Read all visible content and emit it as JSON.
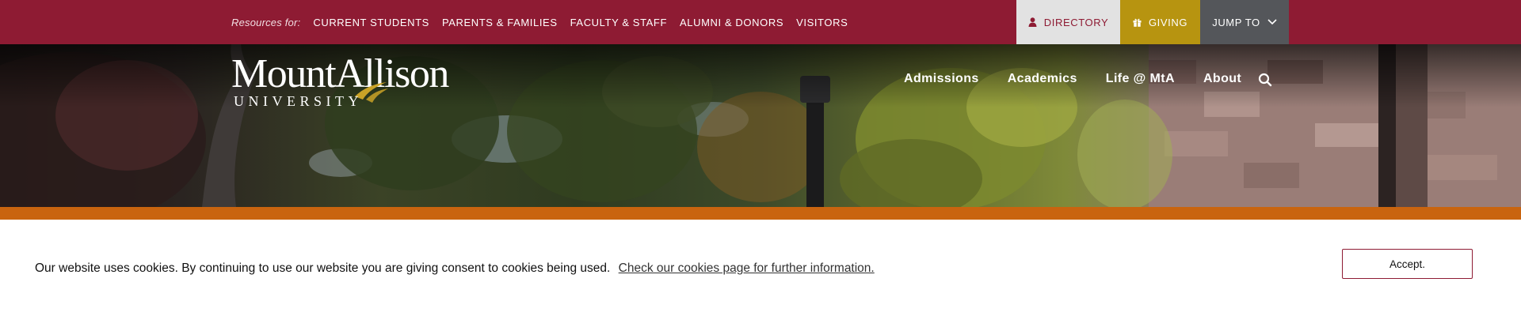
{
  "colors": {
    "topbar_bg": "#8e1b33",
    "directory_bg": "#e2e2e2",
    "giving_bg": "#b79410",
    "jump_bg": "#54565a",
    "accent_stripe": "#c9640f",
    "accept_border": "#8e1b33"
  },
  "topbar": {
    "resources_label": "Resources for:",
    "links": [
      "CURRENT STUDENTS",
      "PARENTS & FAMILIES",
      "FACULTY & STAFF",
      "ALUMNI & DONORS",
      "VISITORS"
    ],
    "directory": {
      "label": "DIRECTORY",
      "icon": "person-icon"
    },
    "giving": {
      "label": "GIVING",
      "icon": "gift-icon"
    },
    "jump_to": {
      "label": "JUMP TO",
      "icon": "chevron-down-icon"
    }
  },
  "header": {
    "logo_main": "MountAllison",
    "logo_sub": "UNIVERSITY",
    "nav": [
      "Admissions",
      "Academics",
      "Life @ MtA",
      "About"
    ],
    "search_icon": "search-icon"
  },
  "cookie": {
    "message": "Our website uses cookies. By continuing to use our website you are giving consent to cookies being used.",
    "link": "Check our cookies page for further information.",
    "accept": "Accept."
  }
}
